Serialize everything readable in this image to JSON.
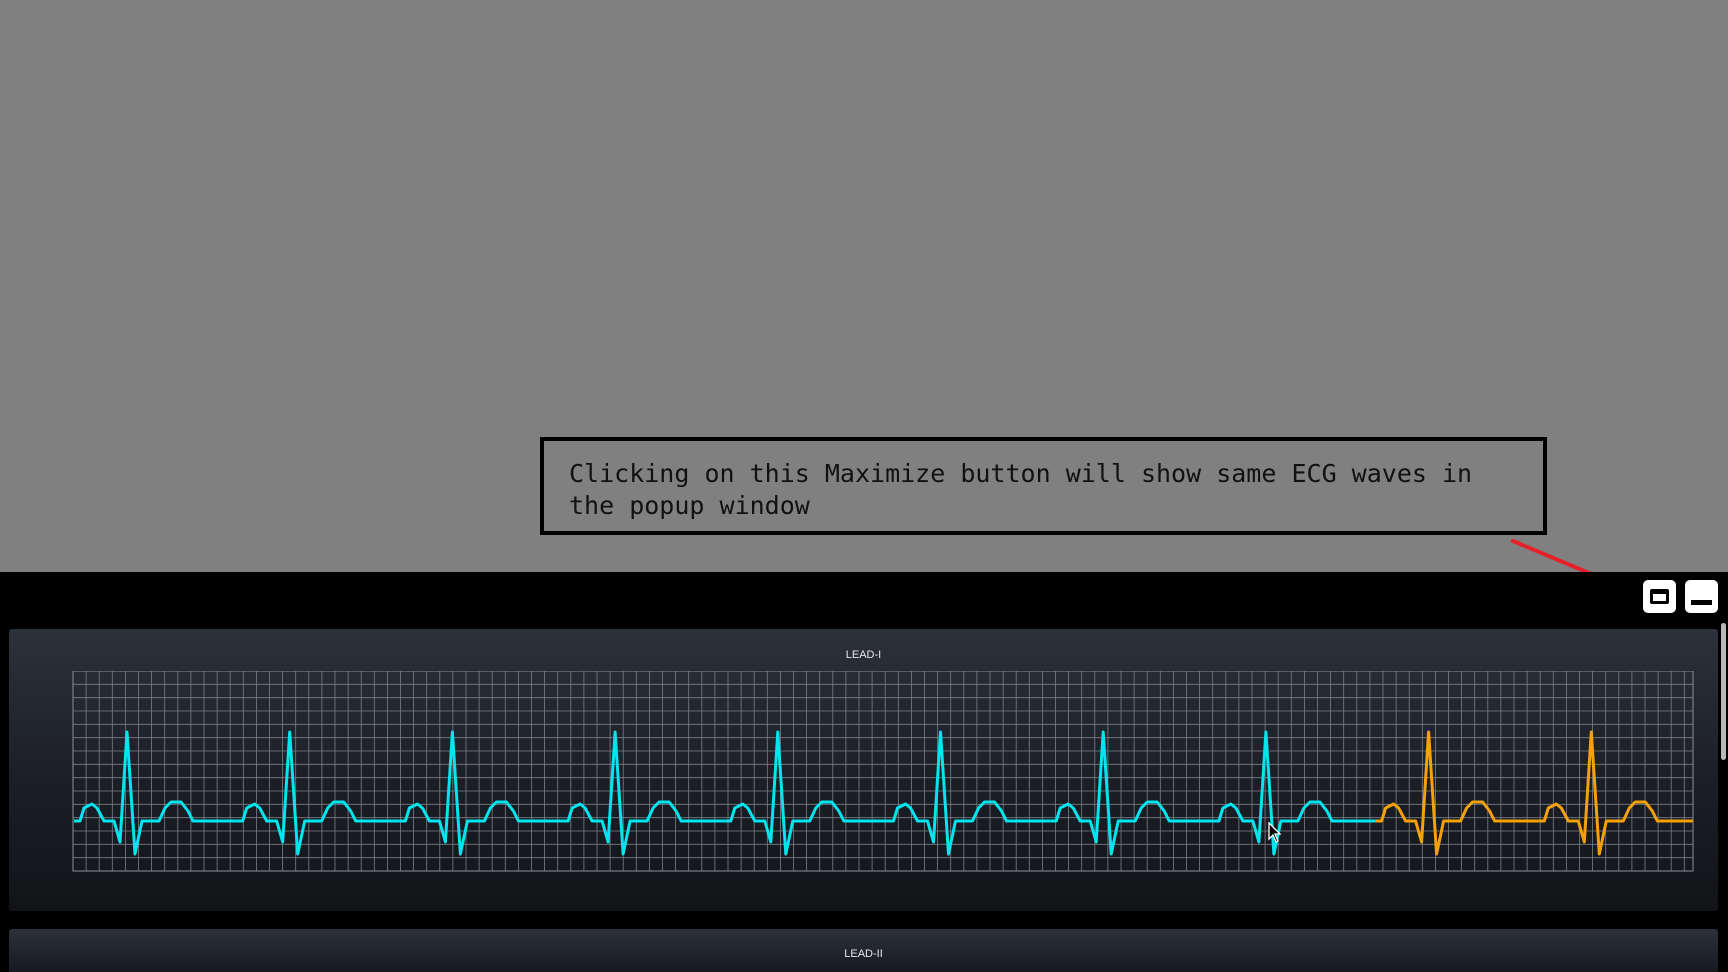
{
  "annotation": {
    "text": "Clicking on this Maximize button will show same ECG waves in the popup window",
    "arrow_color": "#e8202a"
  },
  "window_controls": {
    "maximize_icon": "window-maximize-icon",
    "minimize_icon": "window-minimize-icon"
  },
  "leads": [
    {
      "label": "LEAD-I",
      "traced_color": "#00e5ee",
      "pending_color": "#f5a10a",
      "beats_total": 10,
      "beats_traced": 8,
      "grid_color": "#7a7f88"
    },
    {
      "label": "LEAD-II"
    }
  ],
  "cursor": "mouse-pointer-icon"
}
